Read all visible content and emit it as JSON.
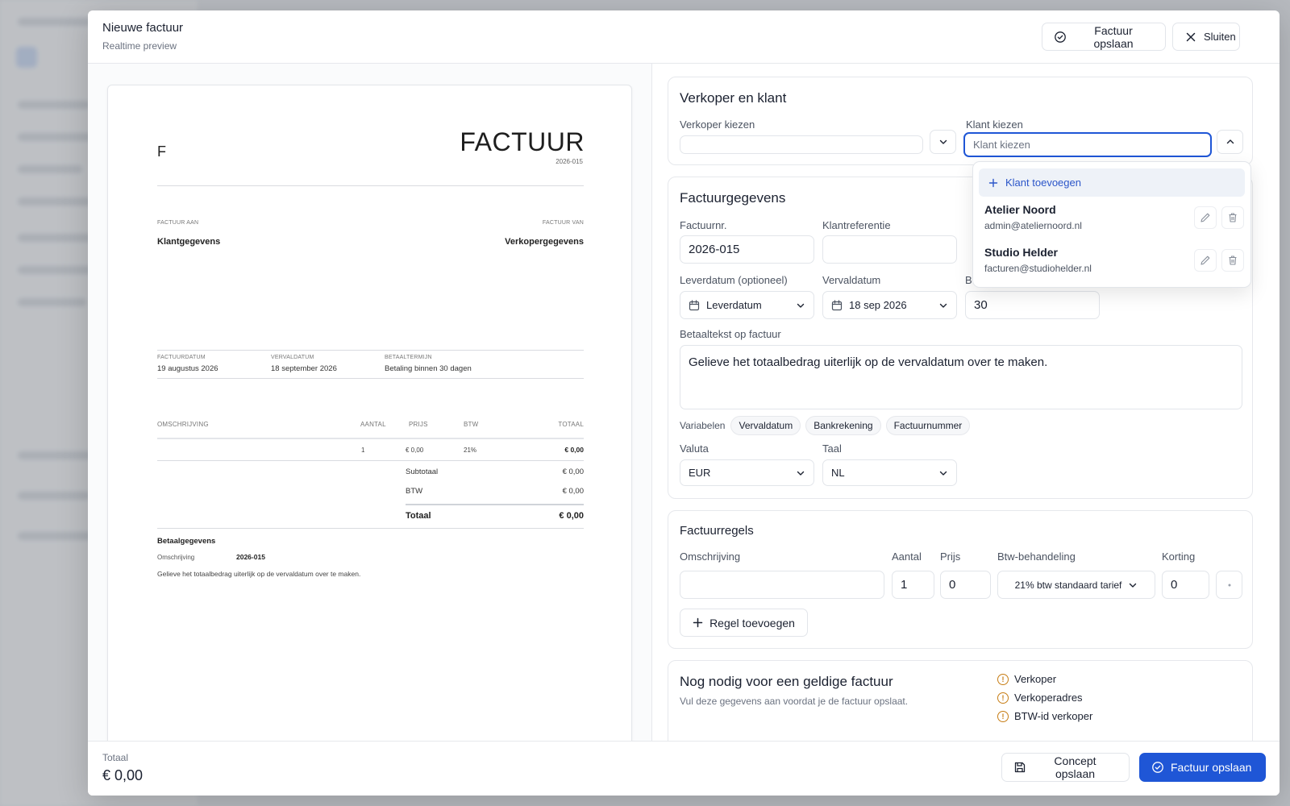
{
  "modal": {
    "title": "Nieuwe factuur",
    "subtitle": "Realtime preview",
    "save_label": "Factuur opslaan",
    "close_label": "Sluiten"
  },
  "preview": {
    "logo_letter": "F",
    "doc_title": "FACTUUR",
    "doc_number": "2026-015",
    "to_caption": "FACTUUR AAN",
    "to_value": "Klantgegevens",
    "from_caption": "FACTUUR VAN",
    "from_value": "Verkopergegevens",
    "date_caption": "FACTUURDATUM",
    "date_value": "19 augustus 2026",
    "due_caption": "VERVALDATUM",
    "due_value": "18 september 2026",
    "term_caption": "BETAALTERMIJN",
    "term_value": "Betaling binnen 30 dagen",
    "columns": [
      "OMSCHRIJVING",
      "AANTAL",
      "PRIJS",
      "BTW",
      "TOTAAL"
    ],
    "row": {
      "qty": "1",
      "price": "€ 0,00",
      "vat": "21%",
      "total": "€ 0,00"
    },
    "subtotal_label": "Subtotaal",
    "subtotal_value": "€ 0,00",
    "vat_label": "BTW",
    "vat_value": "€ 0,00",
    "total_label": "Totaal",
    "total_value": "€ 0,00",
    "payment_title": "Betaalgegevens",
    "payment_desc_label": "Omschrijving",
    "payment_desc_value": "2026-015",
    "payment_text": "Gelieve het totaalbedrag uiterlijk op de vervaldatum over te maken."
  },
  "parties": {
    "title": "Verkoper en klant",
    "seller_label": "Verkoper kiezen",
    "seller_value": "",
    "client_label": "Klant kiezen",
    "client_placeholder": "Klant kiezen"
  },
  "dropdown": {
    "add_label": "Klant toevoegen",
    "clients": [
      {
        "name": "Atelier Noord",
        "email": "admin@ateliernoord.nl"
      },
      {
        "name": "Studio Helder",
        "email": "facturen@studiohelder.nl"
      }
    ]
  },
  "details": {
    "title": "Factuurgegevens",
    "number_label": "Factuurnr.",
    "number_value": "2026-015",
    "ref_label": "Klantreferentie",
    "ref_value": "",
    "delivery_label": "Leverdatum (optioneel)",
    "delivery_value": "Leverdatum",
    "due_label": "Vervaldatum",
    "due_value": "18 sep 2026",
    "term_label_partial": "B",
    "term_value": "30",
    "paytext_label": "Betaaltekst op factuur",
    "paytext_value": "Gelieve het totaalbedrag uiterlijk op de vervaldatum over te maken.",
    "variables_label": "Variabelen",
    "variables": [
      "Vervaldatum",
      "Bankrekening",
      "Factuurnummer"
    ],
    "currency_label": "Valuta",
    "currency_value": "EUR",
    "language_label": "Taal",
    "language_value": "NL"
  },
  "lines": {
    "title": "Factuurregels",
    "desc_label": "Omschrijving",
    "qty_label": "Aantal",
    "price_label": "Prijs",
    "vat_label": "Btw-behandeling",
    "discount_label": "Korting",
    "desc_value": "",
    "qty_value": "1",
    "price_value": "0",
    "vat_value": "21% btw standaard tarief",
    "discount_value": "0",
    "add_label": "Regel toevoegen"
  },
  "required": {
    "title": "Nog nodig voor een geldige factuur",
    "subtitle": "Vul deze gegevens aan voordat je de factuur opslaat.",
    "items": [
      "Verkoper",
      "Verkoperadres",
      "BTW-id verkoper"
    ]
  },
  "footer": {
    "total_label": "Totaal",
    "total_value": "€ 0,00",
    "draft_label": "Concept opslaan",
    "save_label": "Factuur opslaan"
  },
  "colors": {
    "primary": "#1f56d6",
    "warning": "#c77d14",
    "link": "#2c56c9"
  }
}
